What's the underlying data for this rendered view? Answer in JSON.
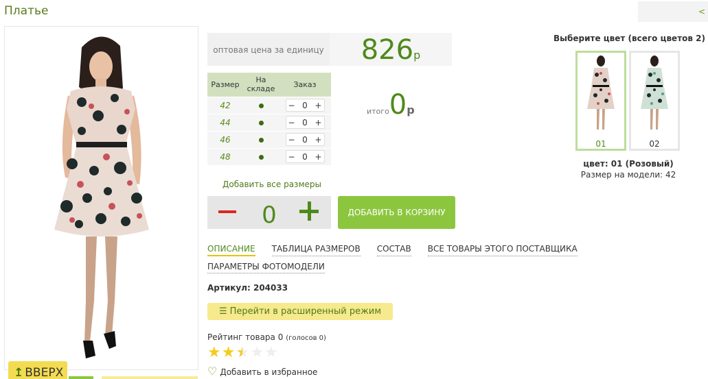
{
  "page": {
    "title": "Платье",
    "nav_arrow": "<"
  },
  "price": {
    "label": "оптовая цена за единицу",
    "value": "826",
    "currency": "р"
  },
  "size_table": {
    "headers": [
      "Размер",
      "На складе",
      "Заказ"
    ],
    "rows": [
      {
        "size": "42",
        "qty": "0"
      },
      {
        "size": "44",
        "qty": "0"
      },
      {
        "size": "46",
        "qty": "0"
      },
      {
        "size": "48",
        "qty": "0"
      }
    ],
    "minus": "−",
    "plus": "+"
  },
  "total": {
    "label": "итого",
    "value": "0",
    "currency": "р"
  },
  "add_all_sizes": "Добавить все размеры",
  "quantity": {
    "value": "0"
  },
  "add_to_cart": "ДОБАВИТЬ В КОРЗИНУ",
  "tabs": [
    {
      "label": "ОПИСАНИЕ"
    },
    {
      "label": "ТАБЛИЦА РАЗМЕРОВ"
    },
    {
      "label": "СОСТАВ"
    },
    {
      "label": "ВСЕ ТОВАРЫ ЭТОГО ПОСТАВЩИКА"
    },
    {
      "label": "ПАРАМЕТРЫ ФОТОМОДЕЛИ"
    }
  ],
  "article": "Артикул: 204033",
  "extended_mode": "Перейти в расширенный режим",
  "rating": {
    "label": "Рейтинг товара 0",
    "votes": "(голосов 0)",
    "score": 2.5,
    "max": 5
  },
  "favorites": "Добавить в избранное",
  "up_button": "ВВЕРХ",
  "colors": {
    "title": "Выберите цвет (всего цветов 2)",
    "options": [
      {
        "num": "01"
      },
      {
        "num": "02"
      }
    ],
    "selected_name": "цвет: 01 (Розовый)",
    "model_size": "Размер на модели: 42"
  },
  "icons": {
    "list": "list-icon",
    "heart": "heart-outline-icon",
    "up": "arrow-up-icon",
    "star": "star-icon"
  },
  "colors_theme": {
    "accent_green": "#8cc63f",
    "price_green": "#4e8a1a",
    "minus_red": "#d9281e",
    "yellow": "#f7e98e",
    "star": "#f5cb1d"
  }
}
